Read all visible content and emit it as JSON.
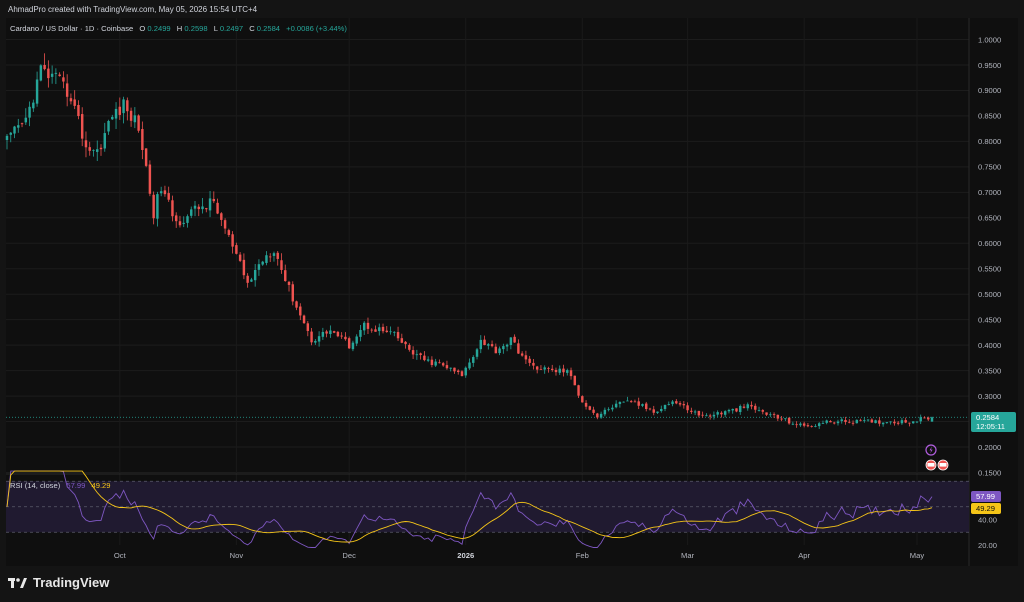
{
  "header": {
    "credit": "AhmadPro created with TradingView.com, May 05, 2026 15:54 UTC+4"
  },
  "legend": {
    "symbol": "Cardano / US Dollar · 1D · Coinbase",
    "o_label": "O",
    "o": "0.2499",
    "h_label": "H",
    "h": "0.2598",
    "l_label": "L",
    "l": "0.2497",
    "c_label": "C",
    "c": "0.2584",
    "change": "+0.0086 (+3.44%)"
  },
  "price_tag": {
    "value": "0.2584",
    "countdown": "12:05:11"
  },
  "rsi_legend": {
    "label": "RSI (14, close)",
    "rsi": "57.99",
    "ma": "49.29"
  },
  "rsi_tags": {
    "rsi": "57.99",
    "ma": "49.29"
  },
  "footer": {
    "brand": "TradingView"
  },
  "colors": {
    "up": "#26a69a",
    "down": "#ef5350",
    "rsi": "#7e57c2",
    "rsi_ma": "#f5c518",
    "background": "#0f0f0f"
  },
  "chart_data": [
    {
      "type": "candlestick",
      "series_name": "Cardano / US Dollar",
      "timeframe": "1D",
      "exchange": "Coinbase",
      "y_ticks": [
        "1.0000",
        "0.9500",
        "0.9000",
        "0.8500",
        "0.8000",
        "0.7500",
        "0.7000",
        "0.6500",
        "0.6000",
        "0.5500",
        "0.5000",
        "0.4500",
        "0.4000",
        "0.3500",
        "0.3000",
        "0.2500",
        "0.2000",
        "0.1500"
      ],
      "ylim": [
        0.15,
        1.0
      ],
      "x_labels": [
        "Oct",
        "Nov",
        "Dec",
        "2026",
        "Feb",
        "Mar",
        "Apr",
        "May"
      ],
      "last_price": 0.2584,
      "anchors": [
        {
          "date": "2025-09-01",
          "price": 0.8
        },
        {
          "date": "2025-09-06",
          "price": 0.84
        },
        {
          "date": "2025-09-10",
          "price": 0.94
        },
        {
          "date": "2025-09-14",
          "price": 0.92
        },
        {
          "date": "2025-09-18",
          "price": 0.89
        },
        {
          "date": "2025-09-22",
          "price": 0.79
        },
        {
          "date": "2025-09-25",
          "price": 0.78
        },
        {
          "date": "2025-09-29",
          "price": 0.85
        },
        {
          "date": "2025-10-02",
          "price": 0.87
        },
        {
          "date": "2025-10-06",
          "price": 0.83
        },
        {
          "date": "2025-10-10",
          "price": 0.66
        },
        {
          "date": "2025-10-12",
          "price": 0.71
        },
        {
          "date": "2025-10-16",
          "price": 0.64
        },
        {
          "date": "2025-10-22",
          "price": 0.67
        },
        {
          "date": "2025-10-26",
          "price": 0.68
        },
        {
          "date": "2025-10-30",
          "price": 0.61
        },
        {
          "date": "2025-11-04",
          "price": 0.52
        },
        {
          "date": "2025-11-08",
          "price": 0.57
        },
        {
          "date": "2025-11-11",
          "price": 0.59
        },
        {
          "date": "2025-11-15",
          "price": 0.51
        },
        {
          "date": "2025-11-21",
          "price": 0.41
        },
        {
          "date": "2025-11-26",
          "price": 0.43
        },
        {
          "date": "2025-12-01",
          "price": 0.4
        },
        {
          "date": "2025-12-05",
          "price": 0.44
        },
        {
          "date": "2025-12-09",
          "price": 0.43
        },
        {
          "date": "2025-12-13",
          "price": 0.42
        },
        {
          "date": "2025-12-17",
          "price": 0.39
        },
        {
          "date": "2025-12-21",
          "price": 0.37
        },
        {
          "date": "2025-12-26",
          "price": 0.36
        },
        {
          "date": "2025-12-31",
          "price": 0.34
        },
        {
          "date": "2026-01-05",
          "price": 0.41
        },
        {
          "date": "2026-01-09",
          "price": 0.39
        },
        {
          "date": "2026-01-13",
          "price": 0.41
        },
        {
          "date": "2026-01-18",
          "price": 0.36
        },
        {
          "date": "2026-01-24",
          "price": 0.35
        },
        {
          "date": "2026-01-28",
          "price": 0.35
        },
        {
          "date": "2026-02-01",
          "price": 0.29
        },
        {
          "date": "2026-02-05",
          "price": 0.26
        },
        {
          "date": "2026-02-09",
          "price": 0.28
        },
        {
          "date": "2026-02-14",
          "price": 0.29
        },
        {
          "date": "2026-02-20",
          "price": 0.27
        },
        {
          "date": "2026-02-25",
          "price": 0.29
        },
        {
          "date": "2026-03-05",
          "price": 0.26
        },
        {
          "date": "2026-03-12",
          "price": 0.27
        },
        {
          "date": "2026-03-17",
          "price": 0.28
        },
        {
          "date": "2026-03-24",
          "price": 0.26
        },
        {
          "date": "2026-04-01",
          "price": 0.24
        },
        {
          "date": "2026-04-08",
          "price": 0.25
        },
        {
          "date": "2026-04-15",
          "price": 0.25
        },
        {
          "date": "2026-04-22",
          "price": 0.25
        },
        {
          "date": "2026-04-29",
          "price": 0.25
        },
        {
          "date": "2026-05-05",
          "price": 0.2584
        }
      ]
    },
    {
      "type": "line",
      "series_name": "RSI (14, close)",
      "y_ticks": [
        "20.00",
        "40.00"
      ],
      "band": [
        30,
        70
      ],
      "ylim": [
        20,
        75
      ],
      "last_values": {
        "rsi": 57.99,
        "ma": 49.29
      }
    }
  ]
}
